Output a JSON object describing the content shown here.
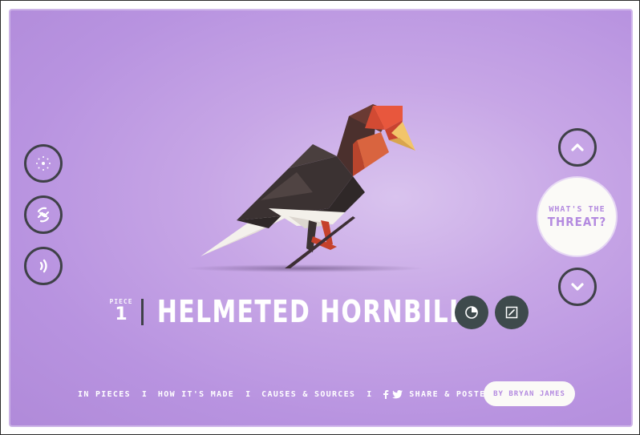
{
  "colors": {
    "background": "#b893e0",
    "accent_text": "#b48be0",
    "circle_border": "#3f4148",
    "dark_button": "#3e4a4c"
  },
  "left_controls": [
    {
      "name": "dots-icon",
      "label": ""
    },
    {
      "name": "shuffle-icon",
      "label": ""
    },
    {
      "name": "sound-icon",
      "label": ""
    }
  ],
  "right_controls": {
    "up_icon": "chevron-up-icon",
    "down_icon": "chevron-down-icon",
    "threat_line1": "WHAT'S THE",
    "threat_line2": "THREAT?"
  },
  "species": {
    "piece_label": "PIECE",
    "piece_number": "1",
    "name": "HELMETED HORNBILL"
  },
  "footer": {
    "nav": [
      "IN PIECES",
      "HOW IT'S MADE",
      "CAUSES & SOURCES"
    ],
    "separator": "I",
    "share": "SHARE & POSTER",
    "credit": "BY BRYAN JAMES"
  }
}
